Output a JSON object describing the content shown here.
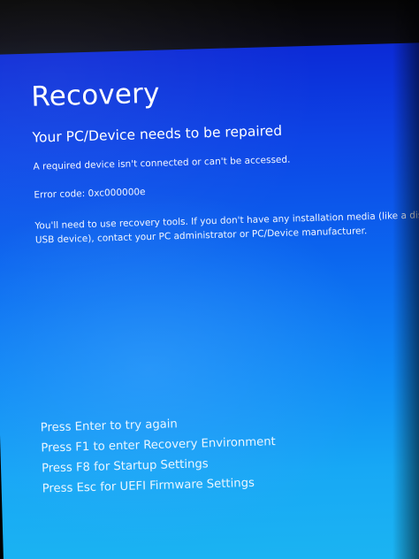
{
  "screen": {
    "title": "Recovery",
    "subtitle": "Your PC/Device needs to be repaired",
    "description": "A required device isn't connected or can't be accessed.",
    "error_code": "Error code: 0xc000000e",
    "instructions_line1": "You'll need to use recovery tools. If you don't have any installation media (like a disc",
    "instructions_line2": "USB device), contact your PC administrator or PC/Device manufacturer.",
    "options": [
      {
        "label": "Press Enter to try again"
      },
      {
        "label": "Press F1 to enter Recovery Environment"
      },
      {
        "label": "Press F8 for Startup Settings"
      },
      {
        "label": "Press Esc for UEFI Firmware Settings"
      }
    ]
  },
  "colors": {
    "background_top": "#0c2ad6",
    "background_bottom": "#1cb6f1",
    "text": "#ffffff"
  }
}
